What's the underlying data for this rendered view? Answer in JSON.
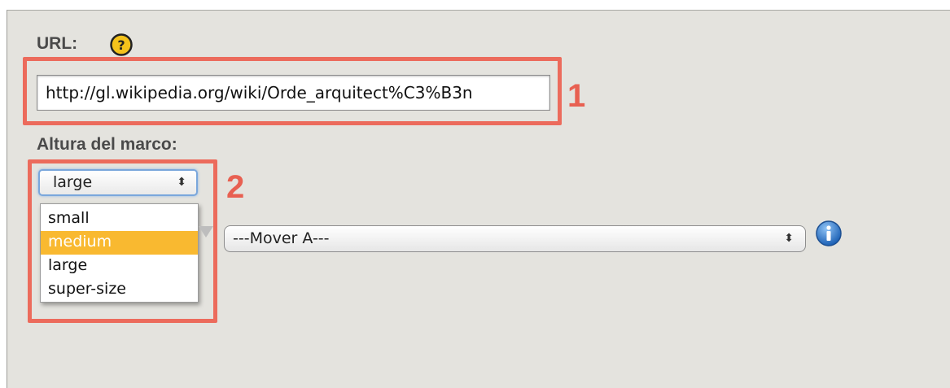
{
  "form": {
    "url_label": "URL:",
    "url_value": "http://gl.wikipedia.org/wiki/Orde_arquitect%C3%B3n",
    "height_label": "Altura del marco:",
    "height_select": {
      "selected": "large",
      "arrows": "⬍",
      "options": [
        "small",
        "medium",
        "large",
        "super-size"
      ],
      "highlighted": "medium"
    },
    "mover_select": {
      "selected": "---Mover A---",
      "arrows": "⬍"
    }
  },
  "callouts": {
    "first": "1",
    "second": "2"
  },
  "icons": {
    "help": "help-icon",
    "info": "info-icon"
  },
  "colors": {
    "callout": "#ec6b5c",
    "highlight": "#f9b930",
    "panel": "#e4e3de"
  }
}
